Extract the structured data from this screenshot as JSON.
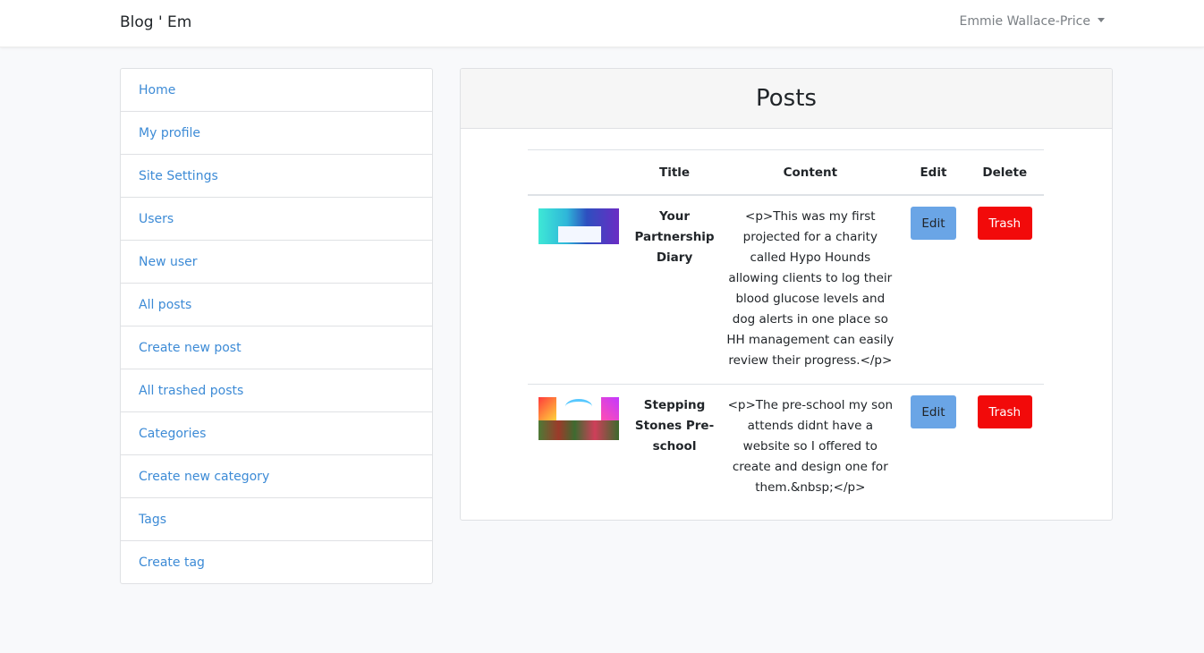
{
  "navbar": {
    "brand": "Blog ' Em",
    "user": "Emmie Wallace-Price"
  },
  "sidebar": {
    "items": [
      {
        "label": "Home"
      },
      {
        "label": "My profile"
      },
      {
        "label": "Site Settings"
      },
      {
        "label": "Users"
      },
      {
        "label": "New user"
      },
      {
        "label": "All posts"
      },
      {
        "label": "Create new post"
      },
      {
        "label": "All trashed posts"
      },
      {
        "label": "Categories"
      },
      {
        "label": "Create new category"
      },
      {
        "label": "Tags"
      },
      {
        "label": "Create tag"
      }
    ]
  },
  "posts": {
    "title": "Posts",
    "columns": {
      "image": "",
      "title": "Title",
      "content": "Content",
      "edit": "Edit",
      "delete": "Delete"
    },
    "rows": [
      {
        "title": "Your Partnership Diary",
        "content": "<p>This was my first projected for a charity called Hypo Hounds allowing clients to log their blood glucose levels and dog alerts in one place so HH management can easily review their progress.</p>",
        "edit_label": "Edit",
        "trash_label": "Trash"
      },
      {
        "title": "Stepping Stones Pre-school",
        "content": "<p>The pre-school my son attends didnt have a website so I offered to create and design one for them.&nbsp;</p>",
        "edit_label": "Edit",
        "trash_label": "Trash"
      }
    ]
  }
}
